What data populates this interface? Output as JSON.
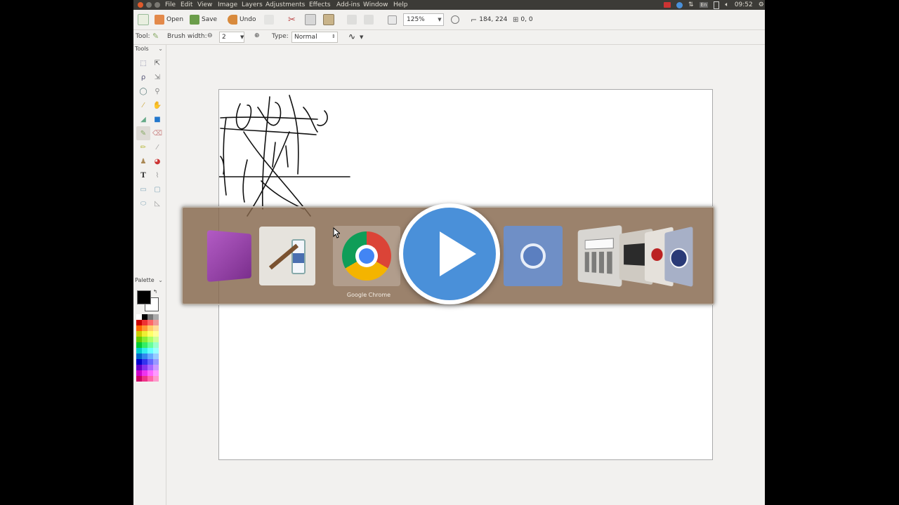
{
  "menubar": {
    "items": [
      "File",
      "Edit",
      "View",
      "Image",
      "Layers",
      "Adjustments",
      "Effects",
      "Add-ins",
      "Window",
      "Help"
    ],
    "tray": {
      "keyboard": "En",
      "clock": "09:52"
    }
  },
  "toolbar": {
    "open_label": "Open",
    "save_label": "Save",
    "undo_label": "Undo",
    "zoom": "125%",
    "cursor_pos": "184, 224",
    "selection_size": "0, 0"
  },
  "options": {
    "tool_label": "Tool:",
    "brush_width_label": "Brush width:",
    "brush_width_value": "2",
    "type_label": "Type:",
    "type_value": "Normal"
  },
  "panels": {
    "tools_title": "Tools",
    "palette_title": "Palette"
  },
  "switcher": {
    "selected_label": "Google Chrome",
    "apps": [
      "app-icon",
      "paint-icon",
      "chrome-icon",
      "chromium-icon",
      "calculator-icon",
      "terminal-icon"
    ]
  },
  "colors": {
    "menubar_bg": "#3c3b37",
    "switcher_bg": "#85674c",
    "play_bg": "#4a90d9",
    "primary_color": "#000000",
    "secondary_color": "#ffffff"
  }
}
